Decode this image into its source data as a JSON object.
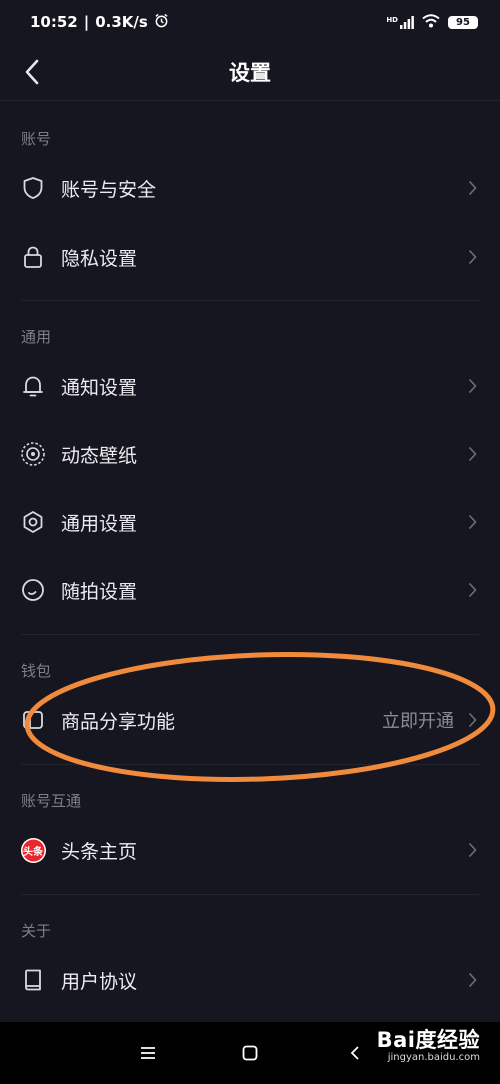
{
  "status_bar": {
    "time": "10:52",
    "speed": "0.3K/s",
    "hd": "HD",
    "battery": "95"
  },
  "header": {
    "title": "设置"
  },
  "sections": {
    "account": {
      "header": "账号",
      "items": [
        {
          "label": "账号与安全",
          "icon": "shield-icon"
        },
        {
          "label": "隐私设置",
          "icon": "lock-icon"
        }
      ]
    },
    "general": {
      "header": "通用",
      "items": [
        {
          "label": "通知设置",
          "icon": "bell-icon"
        },
        {
          "label": "动态壁纸",
          "icon": "wallpaper-icon"
        },
        {
          "label": "通用设置",
          "icon": "gear-icon"
        },
        {
          "label": "随拍设置",
          "icon": "camera-circle-icon"
        }
      ]
    },
    "wallet": {
      "header": "钱包",
      "items": [
        {
          "label": "商品分享功能",
          "value": "立即开通",
          "icon": "goods-share-icon"
        }
      ]
    },
    "linked": {
      "header": "账号互通",
      "items": [
        {
          "label": "头条主页",
          "icon": "toutiao-icon",
          "badge_text": "头条"
        }
      ]
    },
    "about": {
      "header": "关于",
      "items": [
        {
          "label": "用户协议",
          "icon": "book-icon"
        }
      ]
    }
  },
  "colors": {
    "background": "#15161f",
    "highlight": "#f08a3c",
    "toutiao_red": "#e8262c"
  },
  "watermark": {
    "logo": "Bai度经验",
    "url": "jingyan.baidu.com"
  }
}
